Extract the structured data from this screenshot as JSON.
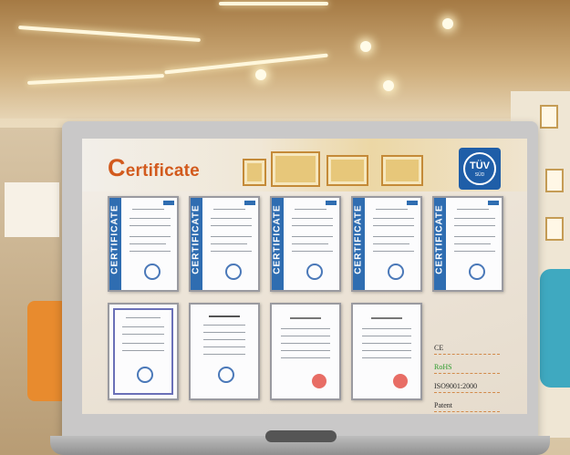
{
  "page": {
    "title_first_letter": "C",
    "title_rest": "ertificate",
    "badge": {
      "main": "TÜV",
      "sub": "SÜD"
    },
    "certificate_band_label": "CERTIFICATE",
    "standards": [
      "CE",
      "RoHS",
      "ISO9001:2000",
      "Patent"
    ]
  },
  "colors": {
    "title": "#d25a1d",
    "cert_band": "#2f6db1",
    "badge": "#1f5ea8",
    "rohs": "#2a9a2a"
  },
  "icons": [
    "tuv-sud-badge-icon",
    "certificate-document-icon"
  ]
}
